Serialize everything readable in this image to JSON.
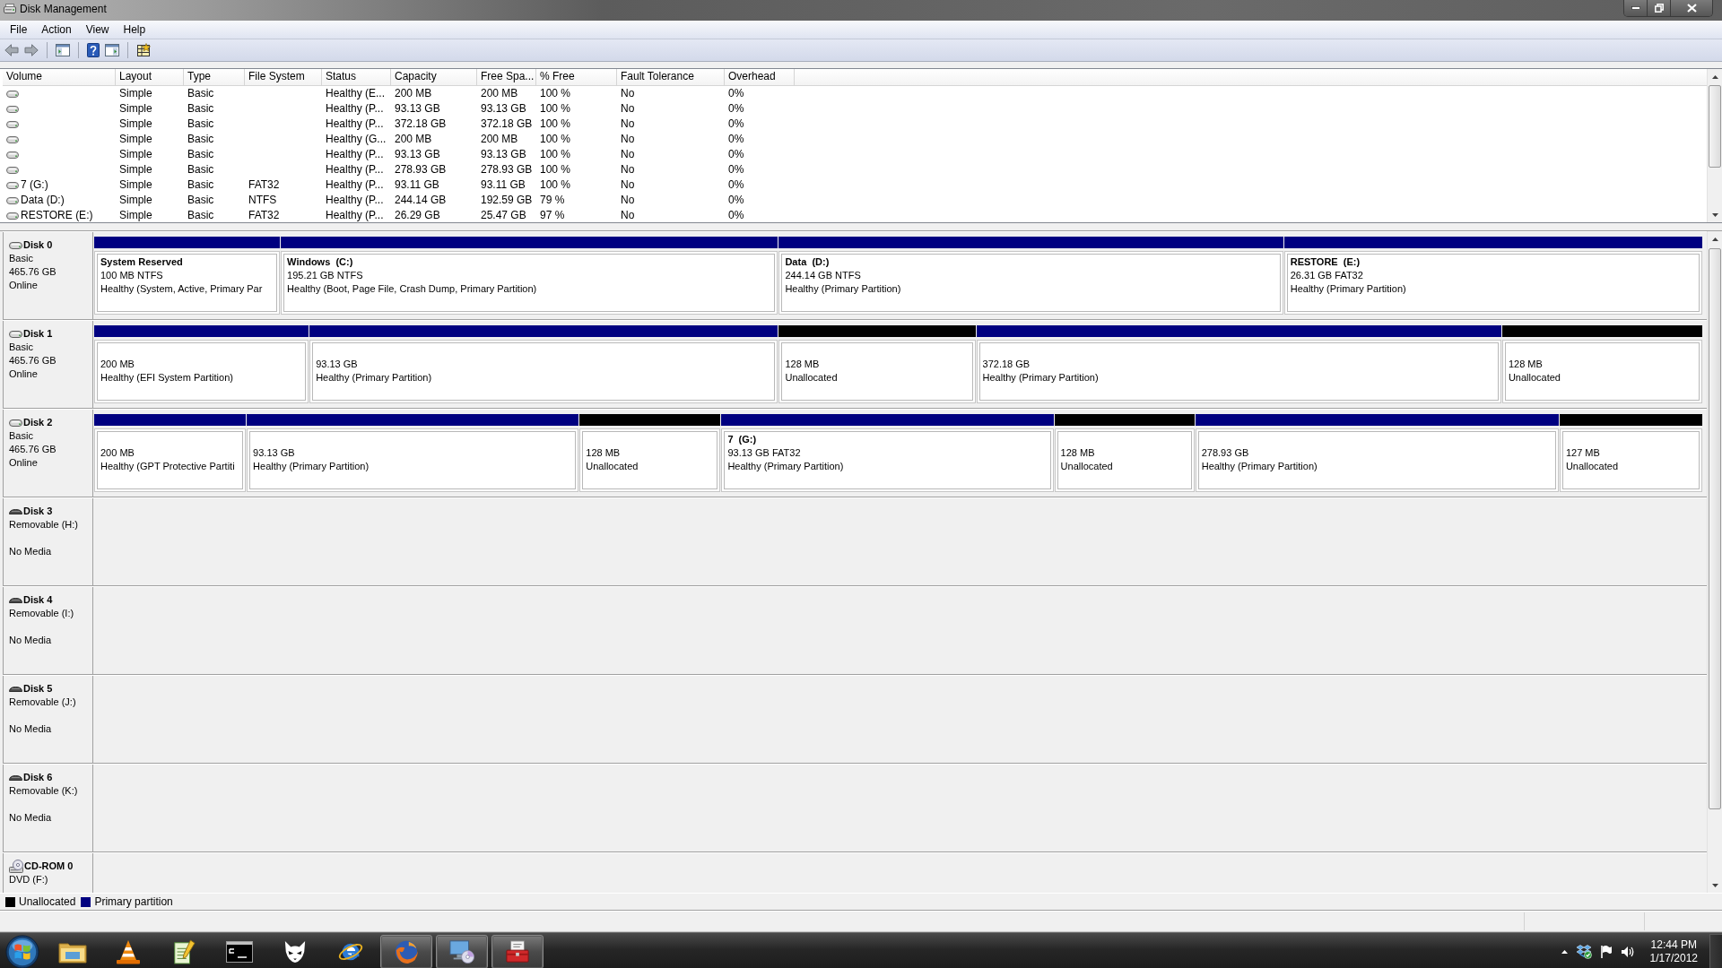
{
  "window": {
    "title": "Disk Management"
  },
  "menu": [
    "File",
    "Action",
    "View",
    "Help"
  ],
  "volume_table": {
    "columns": [
      "Volume",
      "Layout",
      "Type",
      "File System",
      "Status",
      "Capacity",
      "Free Spa...",
      "% Free",
      "Fault Tolerance",
      "Overhead"
    ],
    "rows": [
      {
        "layout": "Simple",
        "volume_type": "Basic",
        "status": "Healthy (E...",
        "capacity": "200 MB",
        "free_space": "200 MB",
        "percent_free": "100 %",
        "fault_tolerance": "No",
        "overhead": "0%"
      },
      {
        "layout": "Simple",
        "volume_type": "Basic",
        "status": "Healthy (P...",
        "capacity": "93.13 GB",
        "free_space": "93.13 GB",
        "percent_free": "100 %",
        "fault_tolerance": "No",
        "overhead": "0%"
      },
      {
        "layout": "Simple",
        "volume_type": "Basic",
        "status": "Healthy (P...",
        "capacity": "372.18 GB",
        "free_space": "372.18 GB",
        "percent_free": "100 %",
        "fault_tolerance": "No",
        "overhead": "0%"
      },
      {
        "layout": "Simple",
        "volume_type": "Basic",
        "status": "Healthy (G...",
        "capacity": "200 MB",
        "free_space": "200 MB",
        "percent_free": "100 %",
        "fault_tolerance": "No",
        "overhead": "0%"
      },
      {
        "layout": "Simple",
        "volume_type": "Basic",
        "status": "Healthy (P...",
        "capacity": "93.13 GB",
        "free_space": "93.13 GB",
        "percent_free": "100 %",
        "fault_tolerance": "No",
        "overhead": "0%"
      },
      {
        "layout": "Simple",
        "volume_type": "Basic",
        "status": "Healthy (P...",
        "capacity": "278.93 GB",
        "free_space": "278.93 GB",
        "percent_free": "100 %",
        "fault_tolerance": "No",
        "overhead": "0%"
      },
      {
        "volume": "7 (G:)",
        "layout": "Simple",
        "volume_type": "Basic",
        "file_system": "FAT32",
        "status": "Healthy (P...",
        "capacity": "93.11 GB",
        "free_space": "93.11 GB",
        "percent_free": "100 %",
        "fault_tolerance": "No",
        "overhead": "0%"
      },
      {
        "volume": "Data (D:)",
        "layout": "Simple",
        "volume_type": "Basic",
        "file_system": "NTFS",
        "status": "Healthy (P...",
        "capacity": "244.14 GB",
        "free_space": "192.59 GB",
        "percent_free": "79 %",
        "fault_tolerance": "No",
        "overhead": "0%"
      },
      {
        "volume": "RESTORE (E:)",
        "layout": "Simple",
        "volume_type": "Basic",
        "file_system": "FAT32",
        "status": "Healthy (P...",
        "capacity": "26.29 GB",
        "free_space": "25.47 GB",
        "percent_free": "97 %",
        "fault_tolerance": "No",
        "overhead": "0%"
      }
    ]
  },
  "disks": [
    {
      "name": "Disk 0",
      "kind": "basic",
      "disk_type": "Basic",
      "size": "465.76 GB",
      "state": "Online",
      "partitions": [
        {
          "name": "System Reserved",
          "size": "100 MB NTFS",
          "status": "Healthy (System, Active, Primary Par",
          "color": "#000080"
        },
        {
          "name": "Windows  (C:)",
          "size": "195.21 GB NTFS",
          "status": "Healthy (Boot, Page File, Crash Dump, Primary Partition)",
          "color": "#000080"
        },
        {
          "name": "Data  (D:)",
          "size": "244.14 GB NTFS",
          "status": "Healthy (Primary Partition)",
          "color": "#000080"
        },
        {
          "name": "RESTORE  (E:)",
          "size": "26.31 GB FAT32",
          "status": "Healthy (Primary Partition)",
          "color": "#000080"
        }
      ]
    },
    {
      "name": "Disk 1",
      "kind": "basic",
      "disk_type": "Basic",
      "size": "465.76 GB",
      "state": "Online",
      "partitions": [
        {
          "size": "200 MB",
          "status": "Healthy (EFI System Partition)",
          "color": "#000080"
        },
        {
          "size": "93.13 GB",
          "status": "Healthy (Primary Partition)",
          "color": "#000080"
        },
        {
          "size": "128 MB",
          "status": "Unallocated",
          "color": "#000000"
        },
        {
          "size": "372.18 GB",
          "status": "Healthy (Primary Partition)",
          "color": "#000080"
        },
        {
          "size": "128 MB",
          "status": "Unallocated",
          "color": "#000000"
        }
      ]
    },
    {
      "name": "Disk 2",
      "kind": "basic",
      "disk_type": "Basic",
      "size": "465.76 GB",
      "state": "Online",
      "partitions": [
        {
          "size": "200 MB",
          "status": "Healthy (GPT Protective Partiti",
          "color": "#000080"
        },
        {
          "size": "93.13 GB",
          "status": "Healthy (Primary Partition)",
          "color": "#000080"
        },
        {
          "size": "128 MB",
          "status": "Unallocated",
          "color": "#000000"
        },
        {
          "name": "7  (G:)",
          "size": "93.13 GB FAT32",
          "status": "Healthy (Primary Partition)",
          "color": "#000080"
        },
        {
          "size": "128 MB",
          "status": "Unallocated",
          "color": "#000000"
        },
        {
          "size": "278.93 GB",
          "status": "Healthy (Primary Partition)",
          "color": "#000080"
        },
        {
          "size": "127 MB",
          "status": "Unallocated",
          "color": "#000000"
        }
      ]
    },
    {
      "name": "Disk 3",
      "kind": "removable",
      "disk_type": "Removable (H:)",
      "state": "No Media"
    },
    {
      "name": "Disk 4",
      "kind": "removable",
      "disk_type": "Removable (I:)",
      "state": "No Media"
    },
    {
      "name": "Disk 5",
      "kind": "removable",
      "disk_type": "Removable (J:)",
      "state": "No Media"
    },
    {
      "name": "Disk 6",
      "kind": "removable",
      "disk_type": "Removable (K:)",
      "state": "No Media"
    },
    {
      "name": "CD-ROM 0",
      "kind": "cdrom",
      "disk_type": "DVD (F:)"
    }
  ],
  "legend": [
    {
      "label": "Unallocated",
      "color": "#000000"
    },
    {
      "label": "Primary partition",
      "color": "#000080"
    }
  ],
  "taskbar": {
    "apps": [
      {
        "running": false
      },
      {
        "running": false
      },
      {
        "running": false
      },
      {
        "running": false
      },
      {
        "running": false
      },
      {
        "running": false
      },
      {
        "running": true
      },
      {
        "running": true
      },
      {
        "running": true
      }
    ],
    "clock": {
      "time": "12:44 PM",
      "date": "1/17/2012"
    }
  }
}
